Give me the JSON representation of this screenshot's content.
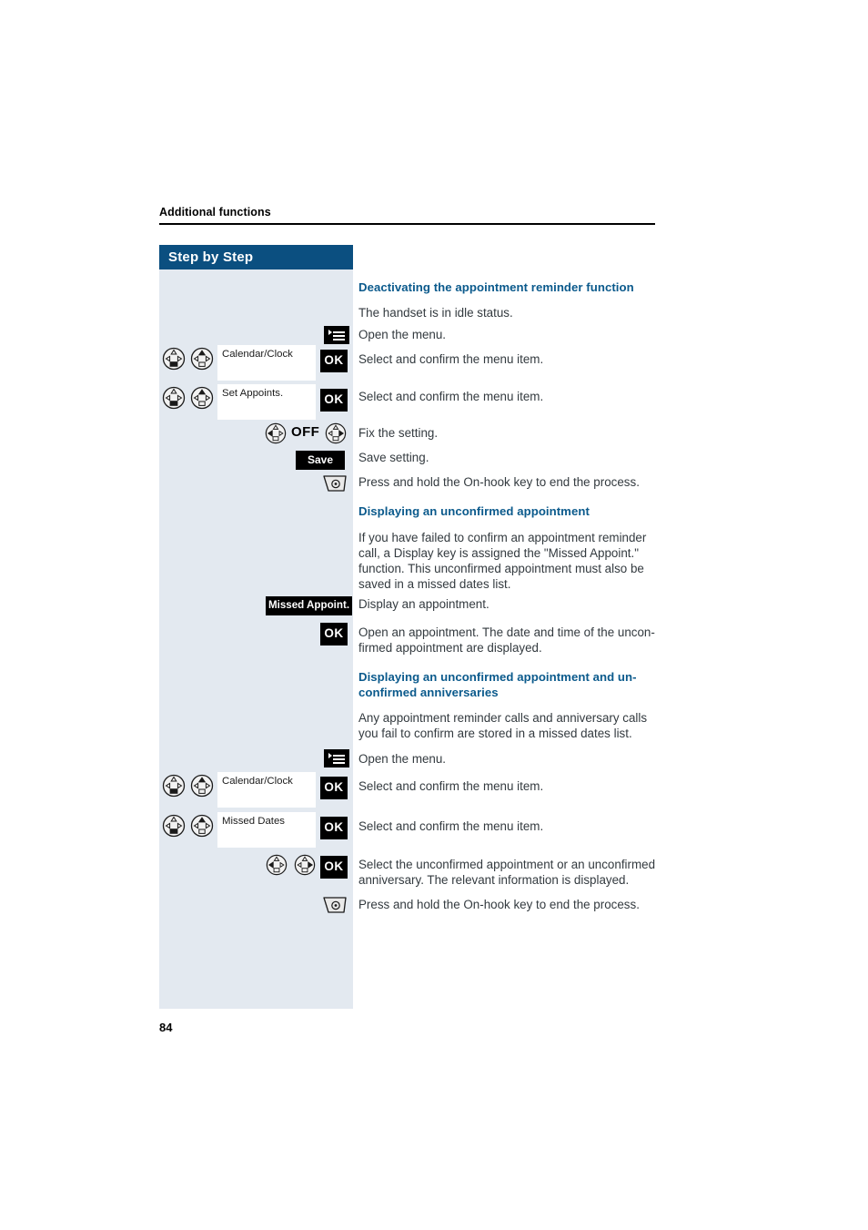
{
  "runhead": "Additional functions",
  "sidebar": {
    "title": "Step by Step"
  },
  "folio": "84",
  "colors": {
    "heading": "#0b5a8c",
    "header_bar": "#0b4f80",
    "sidebar_bg": "#e3e9f0",
    "key": "#000000"
  },
  "sections": [
    {
      "heading": "Deactivating the appointment reminder function",
      "lines": [
        "The handset is in idle status.",
        "Open the menu.",
        "Select and confirm the menu item.",
        "Select and confirm the menu item.",
        "Fix the setting.",
        "Save setting.",
        "Press and hold the On-hook key to end the process."
      ]
    },
    {
      "heading": "Displaying an unconfirmed appointment",
      "body": "If you have failed to confirm an appointment reminder call, a Display key is assigned the \"Missed Appoint.\" function. This unconfirmed appointment must also be saved in a missed dates list.",
      "lines": [
        "Display an appointment.",
        "Open an appointment. The date and time of the uncon-firmed appointment are displayed."
      ]
    },
    {
      "heading": "Displaying an unconfirmed appointment and un-confirmed anniversaries",
      "body": "Any appointment reminder calls and anniversary calls you fail to confirm are stored in a missed dates list.",
      "lines": [
        "Open the menu.",
        "Select and confirm the menu item.",
        "Select and confirm the menu item.",
        "Select the unconfirmed appointment or an unconfirmed anniversary. The relevant information is displayed.",
        "Press and hold the On-hook key to end the process."
      ]
    }
  ],
  "text": {
    "t_idle": "The handset is in idle status.",
    "t_openmenu1": "Open the menu.",
    "t_confirm1": "Select and confirm the menu item.",
    "t_confirm2": "Select and confirm the menu item.",
    "t_fix": "Fix the setting.",
    "t_save": "Save setting.",
    "t_onhook1": "Press and hold the On-hook key to end the process.",
    "h2": "Displaying an unconfirmed appointment",
    "p2_l1": "If you have failed to confirm an appointment reminder",
    "p2_l2": "call, a Display key is assigned the \"Missed Appoint.\"",
    "p2_l3": "function. This unconfirmed appointment must also be",
    "p2_l4": "saved in a missed dates list.",
    "t_display": "Display an appointment.",
    "t_open_l1": "Open an appointment. The date and time of the uncon-",
    "t_open_l2": "firmed appointment are displayed.",
    "h3_l1": "Displaying an unconfirmed appointment and un-",
    "h3_l2": "confirmed anniversaries",
    "p3_l1": "Any appointment reminder calls and anniversary calls",
    "p3_l2": "you fail to confirm are stored in a missed dates list.",
    "t_openmenu2": "Open the menu.",
    "t_confirm3": "Select and confirm the menu item.",
    "t_confirm4": "Select and confirm the menu item.",
    "t_select_l1": "Select the unconfirmed appointment or an unconfirmed",
    "t_select_l2": "anniversary. The relevant information is displayed.",
    "t_onhook2": "Press and hold the On-hook key to end the process."
  },
  "keys": {
    "ok": "OK",
    "save": "Save",
    "missed_appoint": "Missed Appoint.",
    "off": "OFF",
    "menu_icon": "menu-key-icon",
    "onhook_icon": "on-hook-key-icon",
    "nav_down_icon": "navigation-key-down-icon",
    "nav_up_icon": "navigation-key-up-icon",
    "nav_left_icon": "navigation-key-left-icon",
    "nav_right_icon": "navigation-key-right-icon"
  },
  "displays": {
    "calendar_clock_1": "Calendar/Clock",
    "set_appoints": "Set Appoints.",
    "calendar_clock_2": "Calendar/Clock",
    "missed_dates": "Missed Dates"
  }
}
